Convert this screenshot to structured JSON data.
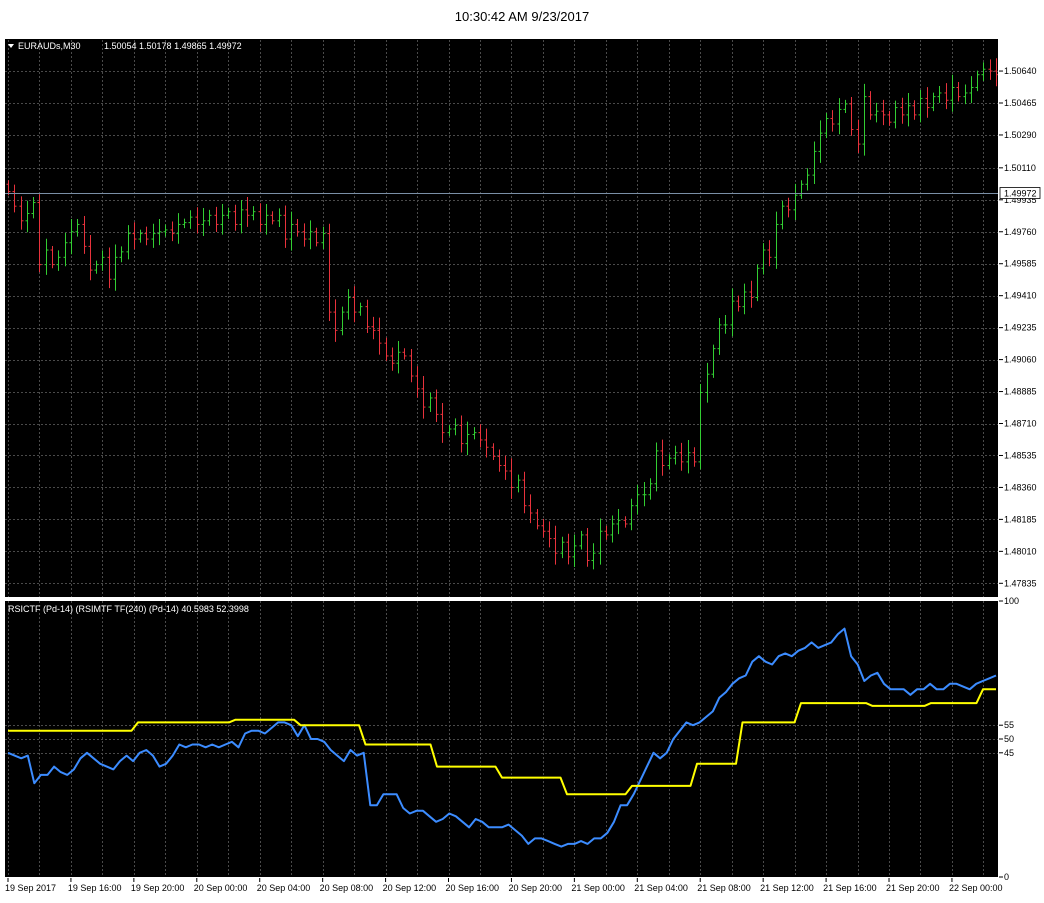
{
  "window": {
    "timestamp": "10:30:42 AM 9/23/2017"
  },
  "colors": {
    "background": "#000000",
    "grid": "#4a4a4a",
    "frame": "#ffffff",
    "bull": "#32cd32",
    "bear": "#e8323c",
    "rsi_current": "#3c8cff",
    "rsi_higher_tf": "#ffff00",
    "current_price_line": "#7a8fa6"
  },
  "chart_data": [
    {
      "type": "candlestick",
      "symbol_label": "EURAUDs,M30",
      "ohlc_label": "1.50054 1.50178 1.49865 1.49972",
      "current_price": 1.49972,
      "current_price_label": "1.49972",
      "ylim": [
        1.4776,
        1.5081
      ],
      "y_ticks": [
        1.5064,
        1.50465,
        1.5029,
        1.5011,
        1.49935,
        1.4976,
        1.49585,
        1.4941,
        1.49235,
        1.4906,
        1.48885,
        1.4871,
        1.48535,
        1.4836,
        1.48185,
        1.4801,
        1.47835
      ],
      "y_tick_labels": [
        "1.50640",
        "1.50465",
        "1.50290",
        "1.50110",
        "1.49935",
        "1.49760",
        "1.49585",
        "1.49410",
        "1.49235",
        "1.49060",
        "1.48885",
        "1.48710",
        "1.48535",
        "1.48360",
        "1.48185",
        "1.48010",
        "1.47835"
      ],
      "x_labels": [
        "19 Sep 2017",
        "19 Sep 16:00",
        "19 Sep 20:00",
        "20 Sep 00:00",
        "20 Sep 04:00",
        "20 Sep 08:00",
        "20 Sep 12:00",
        "20 Sep 16:00",
        "20 Sep 20:00",
        "21 Sep 00:00",
        "21 Sep 04:00",
        "21 Sep 08:00",
        "21 Sep 12:00",
        "21 Sep 16:00",
        "21 Sep 20:00",
        "22 Sep 00:00"
      ],
      "x_label_bar_index": [
        0,
        10,
        20,
        30,
        40,
        50,
        60,
        70,
        80,
        90,
        100,
        110,
        120,
        130,
        140,
        150
      ],
      "closes": [
        1.4998,
        1.499,
        1.4982,
        1.4986,
        1.4992,
        1.4958,
        1.4966,
        1.4958,
        1.4962,
        1.497,
        1.4976,
        1.498,
        1.4968,
        1.4955,
        1.4958,
        1.4962,
        1.495,
        1.4962,
        1.4965,
        1.4975,
        1.4972,
        1.4975,
        1.4972,
        1.4975,
        1.4976,
        1.4977,
        1.4975,
        1.498,
        1.4981,
        1.4984,
        1.498,
        1.4982,
        1.4985,
        1.498,
        1.4985,
        1.4987,
        1.498,
        1.4988,
        1.4985,
        1.4987,
        1.498,
        1.4985,
        1.4982,
        1.4985,
        1.4972,
        1.498,
        1.4976,
        1.4972,
        1.4976,
        1.497,
        1.4975,
        1.4932,
        1.4922,
        1.4932,
        1.494,
        1.4932,
        1.4935,
        1.4924,
        1.4922,
        1.4915,
        1.4908,
        1.4904,
        1.491,
        1.4908,
        1.4897,
        1.489,
        1.488,
        1.4885,
        1.4876,
        1.4866,
        1.4868,
        1.487,
        1.486,
        1.4865,
        1.4866,
        1.4862,
        1.4858,
        1.4853,
        1.4848,
        1.4845,
        1.4836,
        1.484,
        1.4826,
        1.4822,
        1.4815,
        1.4812,
        1.4808,
        1.48,
        1.4806,
        1.4798,
        1.4804,
        1.481,
        1.4796,
        1.48,
        1.4812,
        1.481,
        1.4816,
        1.4818,
        1.4816,
        1.4826,
        1.4832,
        1.4832,
        1.4838,
        1.4856,
        1.4848,
        1.4852,
        1.4855,
        1.485,
        1.4855,
        1.485,
        1.4888,
        1.4898,
        1.4912,
        1.4925,
        1.4925,
        1.4938,
        1.4935,
        1.4943,
        1.494,
        1.4956,
        1.4966,
        1.4962,
        1.498,
        1.499,
        1.4988,
        1.4996,
        1.5002,
        1.5007,
        1.502,
        1.503,
        1.5038,
        1.5035,
        1.5043,
        1.5046,
        1.5032,
        1.5024,
        1.505,
        1.504,
        1.5042,
        1.504,
        1.5036,
        1.5044,
        1.504,
        1.5045,
        1.504,
        1.5049,
        1.5044,
        1.505,
        1.5052,
        1.5048,
        1.5055,
        1.505,
        1.5052,
        1.5055,
        1.5062,
        1.5065,
        1.5064,
        1.5062
      ]
    },
    {
      "type": "line",
      "label": "RSICTF (Pd-14) (RSIMTF TF(240) (Pd-14) 40.5983 52.3998",
      "ylim": [
        0,
        100
      ],
      "y_ticks": [
        100,
        55,
        50,
        45,
        0
      ],
      "levels": [
        55,
        50,
        45
      ],
      "series": [
        {
          "key": "rsi_current",
          "values": [
            45,
            44,
            43,
            44,
            34,
            37,
            37,
            40,
            38,
            37,
            39,
            43,
            45,
            43,
            41,
            40,
            39,
            42,
            44,
            42,
            45,
            46,
            44,
            40,
            41,
            44,
            48,
            47,
            48,
            48,
            47,
            48,
            47,
            48,
            49,
            47,
            52,
            53,
            53,
            52,
            54,
            56,
            56,
            55,
            51,
            55,
            50,
            50,
            49,
            46,
            44,
            42,
            46,
            44,
            45,
            26,
            26,
            30,
            30,
            30,
            25,
            23,
            24,
            24,
            22,
            20,
            21,
            23,
            22,
            20,
            18,
            21,
            20,
            18,
            18,
            18,
            19,
            17,
            15,
            12,
            14,
            14,
            13,
            12,
            11,
            12,
            12,
            13,
            12,
            14,
            14,
            16,
            20,
            26,
            26,
            30,
            35,
            40,
            45,
            43,
            45,
            50,
            53,
            56,
            55,
            56,
            58,
            60,
            65,
            67,
            70,
            72,
            73,
            78,
            80,
            78,
            77,
            80,
            81,
            80,
            82,
            83,
            85,
            83,
            84,
            85,
            88,
            90,
            80,
            77,
            71,
            73,
            74,
            70,
            68,
            68,
            68,
            66,
            68,
            68,
            70,
            68,
            68,
            70,
            70,
            69,
            68,
            70,
            71,
            72,
            73
          ]
        },
        {
          "key": "rsi_higher_tf",
          "values": [
            53,
            53,
            53,
            53,
            53,
            53,
            53,
            53,
            53,
            53,
            53,
            53,
            53,
            53,
            53,
            53,
            53,
            53,
            53,
            53,
            56,
            56,
            56,
            56,
            56,
            56,
            56,
            56,
            56,
            56,
            56,
            56,
            56,
            56,
            56,
            57,
            57,
            57,
            57,
            57,
            57,
            57,
            57,
            57,
            57,
            55,
            55,
            55,
            55,
            55,
            55,
            55,
            55,
            55,
            55,
            48,
            48,
            48,
            48,
            48,
            48,
            48,
            48,
            48,
            48,
            48,
            40,
            40,
            40,
            40,
            40,
            40,
            40,
            40,
            40,
            40,
            36,
            36,
            36,
            36,
            36,
            36,
            36,
            36,
            36,
            36,
            30,
            30,
            30,
            30,
            30,
            30,
            30,
            30,
            30,
            30,
            33,
            33,
            33,
            33,
            33,
            33,
            33,
            33,
            33,
            33,
            41,
            41,
            41,
            41,
            41,
            41,
            41,
            56,
            56,
            56,
            56,
            56,
            56,
            56,
            56,
            56,
            63,
            63,
            63,
            63,
            63,
            63,
            63,
            63,
            63,
            63,
            63,
            62,
            62,
            62,
            62,
            62,
            62,
            62,
            62,
            62,
            63,
            63,
            63,
            63,
            63,
            63,
            63,
            63,
            68,
            68,
            68
          ]
        }
      ]
    }
  ]
}
